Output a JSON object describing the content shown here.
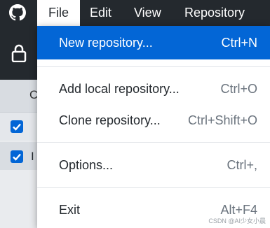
{
  "menubar": {
    "logo_icon": "github-icon",
    "items": [
      {
        "label": "File"
      },
      {
        "label": "Edit"
      },
      {
        "label": "View"
      },
      {
        "label": "Repository"
      }
    ],
    "active": "File"
  },
  "toolbar": {
    "lock_icon": "lock-icon"
  },
  "background_panel": {
    "tab_label": "C",
    "rows": [
      {
        "checked": true,
        "label": ""
      },
      {
        "checked": true,
        "label": "I"
      }
    ]
  },
  "file_menu": {
    "items": [
      {
        "label": "New repository...",
        "shortcut": "Ctrl+N",
        "highlighted": true
      },
      {
        "label": "Add local repository...",
        "shortcut": "Ctrl+O"
      },
      {
        "label": "Clone repository...",
        "shortcut": "Ctrl+Shift+O"
      },
      {
        "label": "Options...",
        "shortcut": "Ctrl+,"
      },
      {
        "label": "Exit",
        "shortcut": "Alt+F4"
      }
    ]
  },
  "watermark": "CSDN @AI少女小晨",
  "colors": {
    "menubar_bg": "#24292e",
    "highlight": "#0366d6",
    "checkbox": "#0366d6"
  }
}
